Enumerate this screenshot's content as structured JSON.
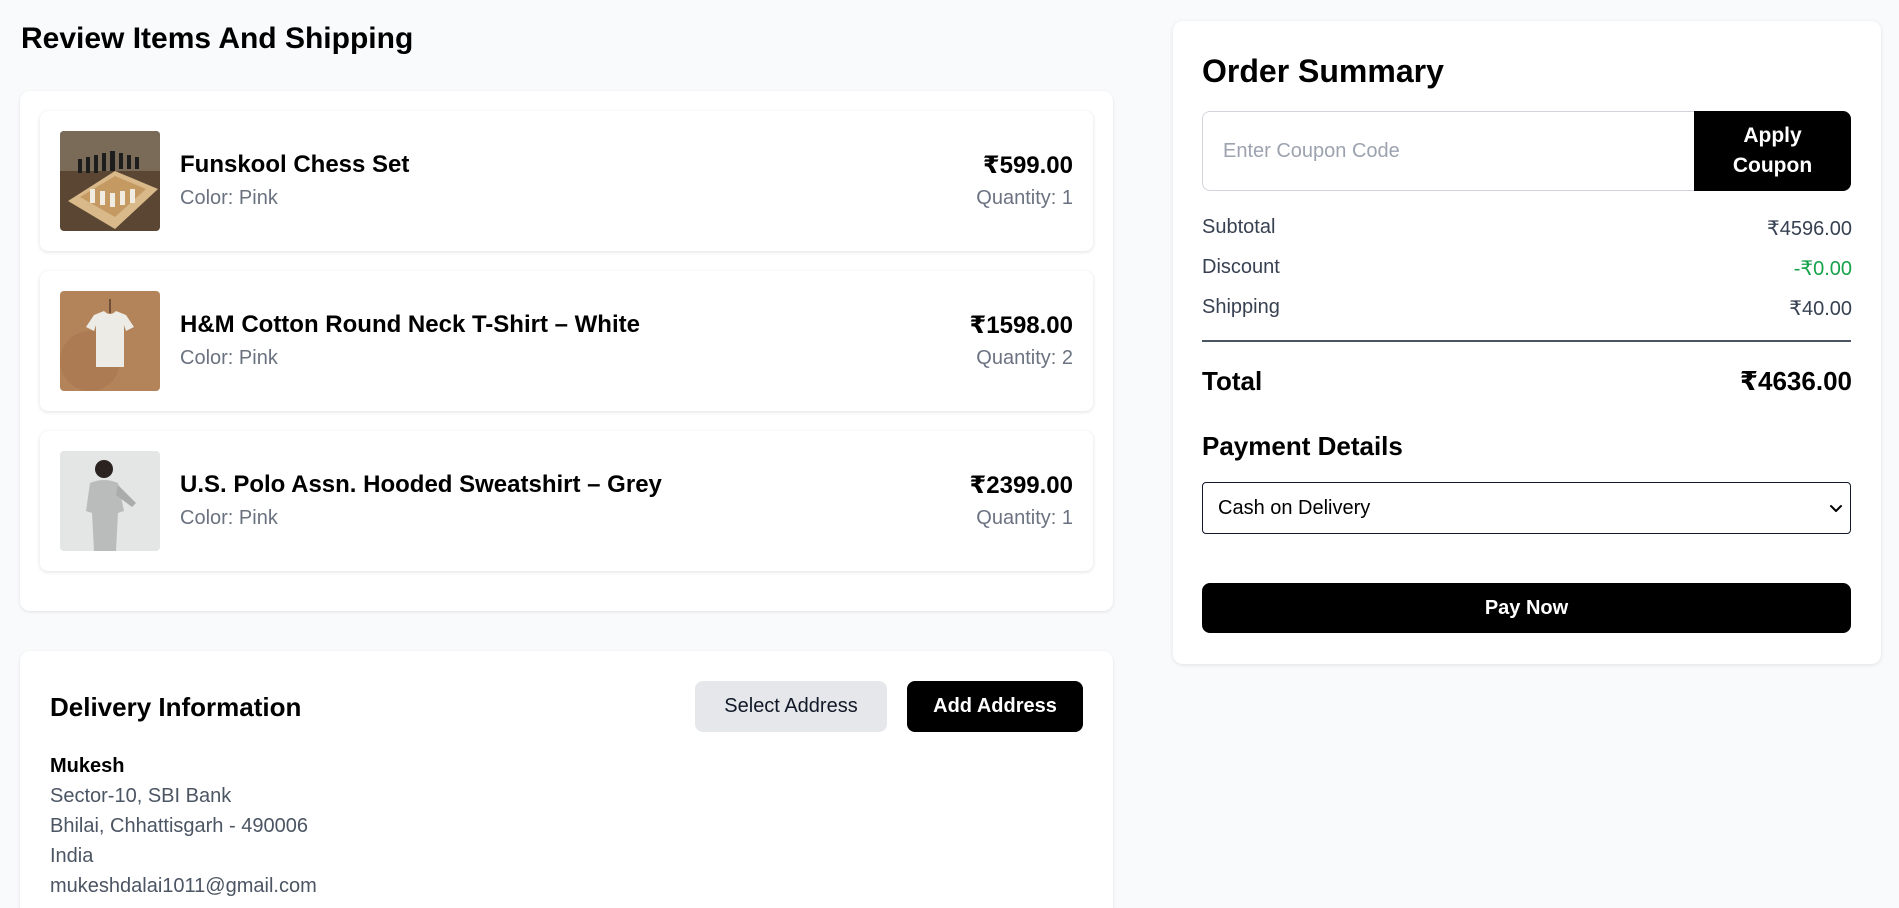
{
  "page_title": "Review Items And Shipping",
  "items": [
    {
      "name": "Funskool Chess Set",
      "color": "Color: Pink",
      "price": "₹599.00",
      "quantity": "Quantity: 1",
      "thumb_icon": "chess-set-image"
    },
    {
      "name": "H&M Cotton Round Neck T-Shirt – White",
      "color": "Color: Pink",
      "price": "₹1598.00",
      "quantity": "Quantity: 2",
      "thumb_icon": "tshirt-image"
    },
    {
      "name": "U.S. Polo Assn. Hooded Sweatshirt – Grey",
      "color": "Color: Pink",
      "price": "₹2399.00",
      "quantity": "Quantity: 1",
      "thumb_icon": "sweatshirt-image"
    }
  ],
  "delivery": {
    "title": "Delivery Information",
    "select_address_label": "Select Address",
    "add_address_label": "Add Address",
    "name": "Mukesh",
    "line1": "Sector-10, SBI Bank",
    "line2": "Bhilai, Chhattisgarh - 490006",
    "country": "India",
    "email": "mukeshdalai1011@gmail.com"
  },
  "summary": {
    "title": "Order Summary",
    "coupon_placeholder": "Enter Coupon Code",
    "coupon_value": "",
    "apply_coupon_label": "Apply Coupon",
    "subtotal_label": "Subtotal",
    "subtotal_value": "₹4596.00",
    "discount_label": "Discount",
    "discount_value": "-₹0.00",
    "shipping_label": "Shipping",
    "shipping_value": "₹40.00",
    "total_label": "Total",
    "total_value": "₹4636.00",
    "payment_title": "Payment Details",
    "payment_selected": "Cash on Delivery",
    "pay_now_label": "Pay Now"
  },
  "colors": {
    "background": "#f9fafb",
    "primary": "#000000",
    "muted_text": "#6b7280",
    "discount_green": "#16a34a",
    "secondary_button": "#e5e7eb"
  }
}
